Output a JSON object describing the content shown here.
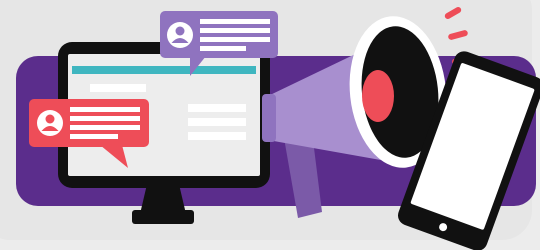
{
  "illustration": {
    "subject": "megaphone-announcement",
    "icons": [
      "desktop-monitor-icon",
      "megaphone-icon",
      "tablet-icon",
      "chat-bubble-icon",
      "user-avatar-icon"
    ],
    "colors": {
      "background": "#ececec",
      "background_panel": "#e4e4e4",
      "purple_band": "#5b2d8c",
      "purple_light": "#8f73bf",
      "megaphone_body": "#a88fcf",
      "megaphone_handle": "#7b5aa8",
      "red_accent": "#ee4d58",
      "black": "#111111",
      "screen_bg": "#ededed",
      "screen_header": "#3fb6c0",
      "white": "#ffffff"
    }
  }
}
